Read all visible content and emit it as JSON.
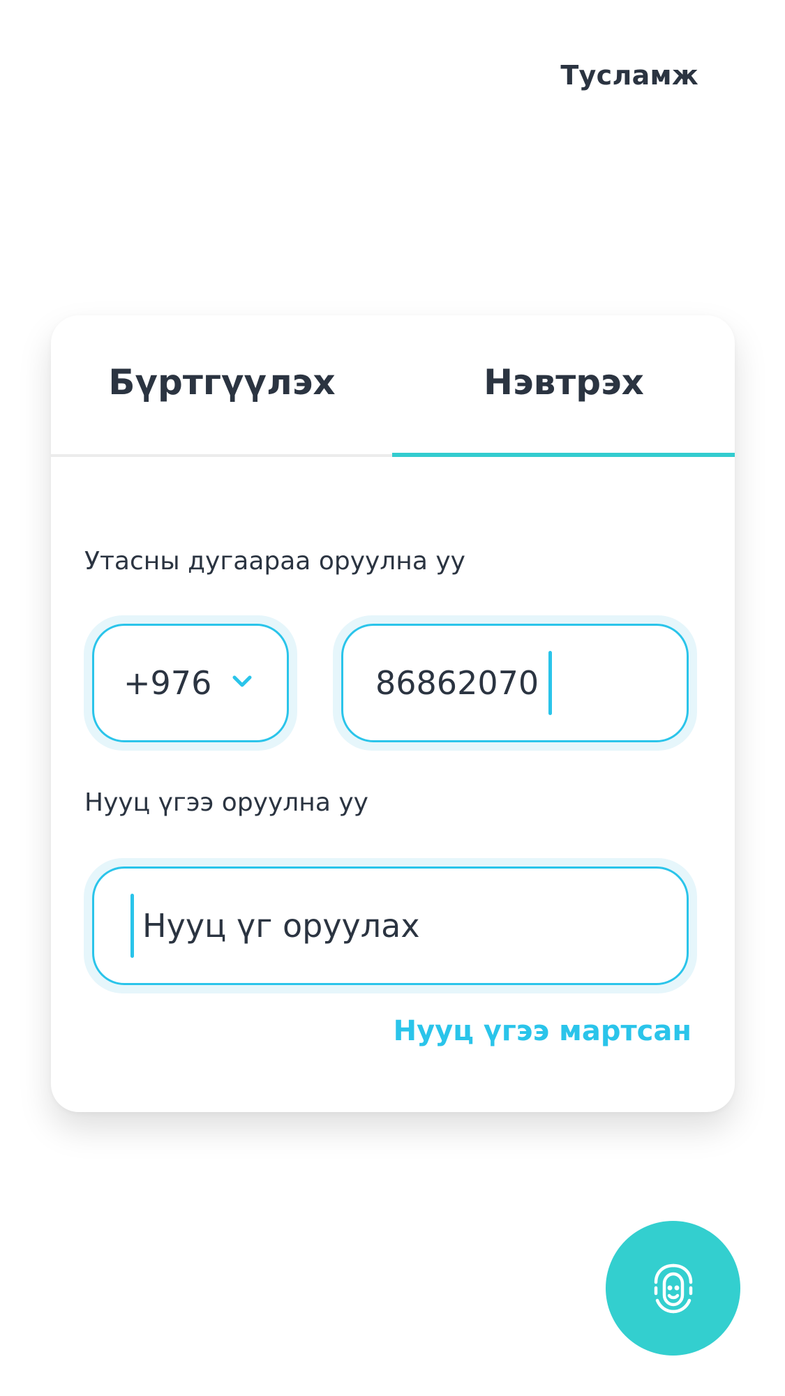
{
  "header": {
    "help_label": "Тусламж"
  },
  "tabs": [
    {
      "label": "Бүртгүүлэх",
      "active": false
    },
    {
      "label": "Нэвтрэх",
      "active": true
    }
  ],
  "form": {
    "phone_label": "Утасны дугаараа оруулна уу",
    "country_code": "+976",
    "phone_value": "86862070",
    "password_label": "Нууц үгээ оруулна уу",
    "password_placeholder": "Нууц үг оруулах",
    "forgot_label": "Нууц үгээ мартсан"
  },
  "icons": {
    "dropdown": "chevron-down-icon",
    "biometric": "face-id-icon"
  },
  "colors": {
    "accent_teal": "#33cccf",
    "accent_blue": "#2ac4ea",
    "text_dark": "#2b3441",
    "field_halo": "#e6f6fb"
  }
}
